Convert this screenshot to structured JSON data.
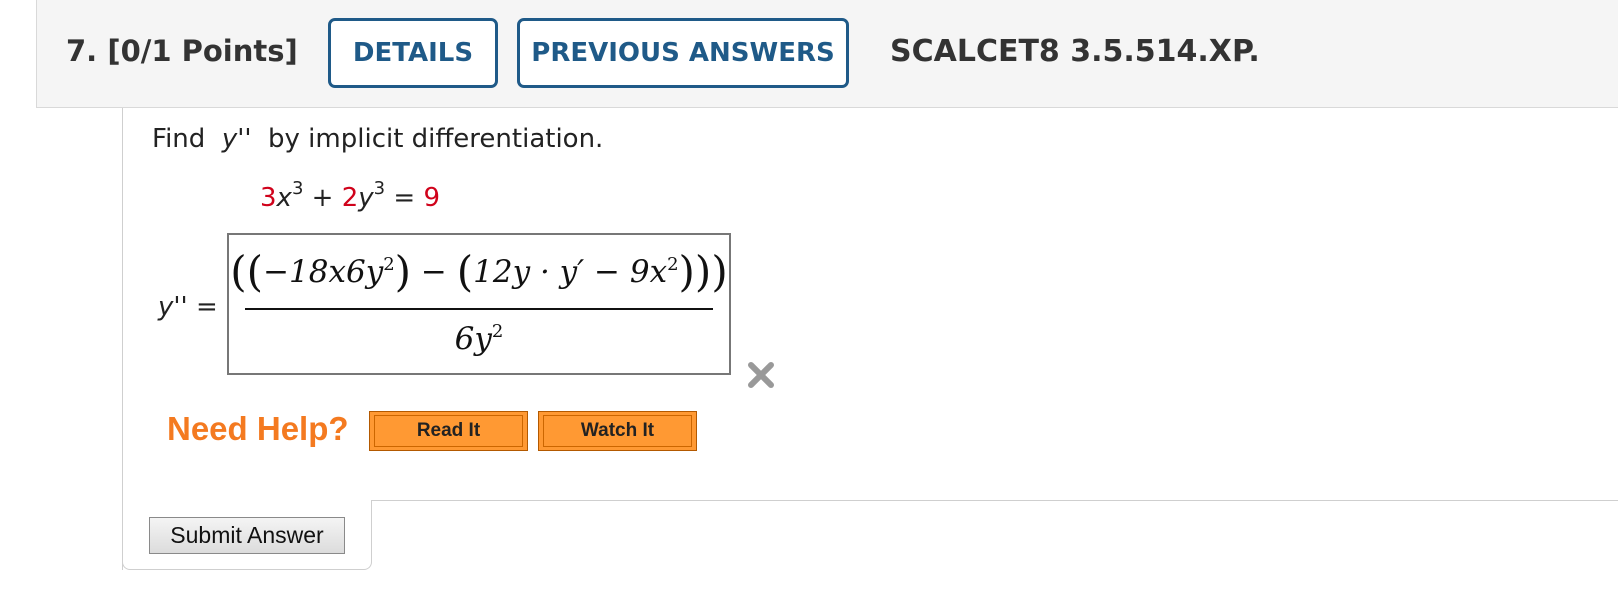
{
  "question": {
    "number": "7.",
    "points": "[0/1 Points]",
    "details_label": "DETAILS",
    "previous_answers_label": "PREVIOUS ANSWERS",
    "course_id": "SCALCET8 3.5.514.XP."
  },
  "problem": {
    "prompt_find": "Find",
    "prompt_symbol": "y''",
    "prompt_rest": "by implicit differentiation.",
    "equation": {
      "coef1": "3",
      "var1": "x",
      "exp1": "3",
      "plus": "+",
      "coef2": "2",
      "var2": "y",
      "exp2": "3",
      "equals": "=",
      "rhs": "9"
    }
  },
  "answer": {
    "label": "y'' =",
    "numerator": {
      "open": "((",
      "term1": "−18x6y",
      "term1_exp": "2",
      "close_inner1": ")",
      "minus": " − ",
      "open2": "(",
      "term2": "12y · y′ − 9x",
      "term2_exp": "2",
      "close": ")))"
    },
    "denominator": "6y",
    "denominator_exp": "2",
    "status_icon": "wrong-x-icon",
    "status_color": "#999999"
  },
  "help": {
    "label": "Need Help?",
    "read_it": "Read It",
    "watch_it": "Watch It"
  },
  "submit": {
    "label": "Submit Answer"
  },
  "colors": {
    "accent_blue": "#1f5a88",
    "coefficient_red": "#d0021b",
    "help_orange": "#f47a20",
    "button_orange": "#ff9933"
  }
}
